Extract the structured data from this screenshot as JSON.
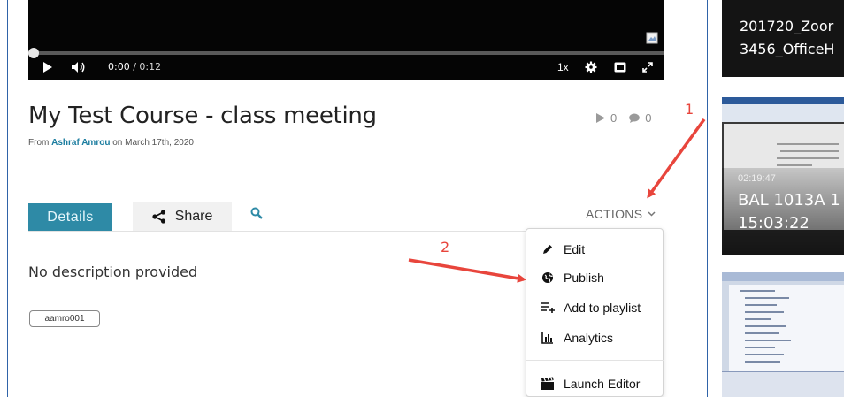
{
  "player": {
    "current_time": "0:00",
    "duration": "/ 0:12",
    "speed": "1x",
    "progress_fraction": 0
  },
  "video": {
    "title": "My Test Course - class meeting",
    "from_label": "From",
    "author": "Ashraf Amrou",
    "date_text": "on March 17th, 2020",
    "plays": "0",
    "comments": "0"
  },
  "tabs": {
    "details": "Details",
    "share": "Share",
    "actions": "ACTIONS"
  },
  "description": "No description provided",
  "tag": "aamro001",
  "actions_menu": [
    {
      "label": "Edit",
      "icon": "pencil-icon"
    },
    {
      "label": "Publish",
      "icon": "globe-icon"
    },
    {
      "label": "Add to playlist",
      "icon": "add-to-playlist-icon"
    },
    {
      "label": "Analytics",
      "icon": "bar-chart-icon"
    },
    {
      "label": "Launch Editor",
      "icon": "clapperboard-icon"
    }
  ],
  "annotations": {
    "step1": "1",
    "step2": "2",
    "color": "#e8453c"
  },
  "sidebar_thumbs": {
    "thumb1_line1": "201720_Zoor",
    "thumb1_line2": "3456_OfficeH",
    "thumb2_duration": "02:19:47",
    "thumb2_line1": "BAL 1013A 1",
    "thumb2_line2": "15:03:22"
  },
  "colors": {
    "accent": "#2e8aa6",
    "link": "#1d7ea0",
    "frame": "#2f63a8"
  }
}
